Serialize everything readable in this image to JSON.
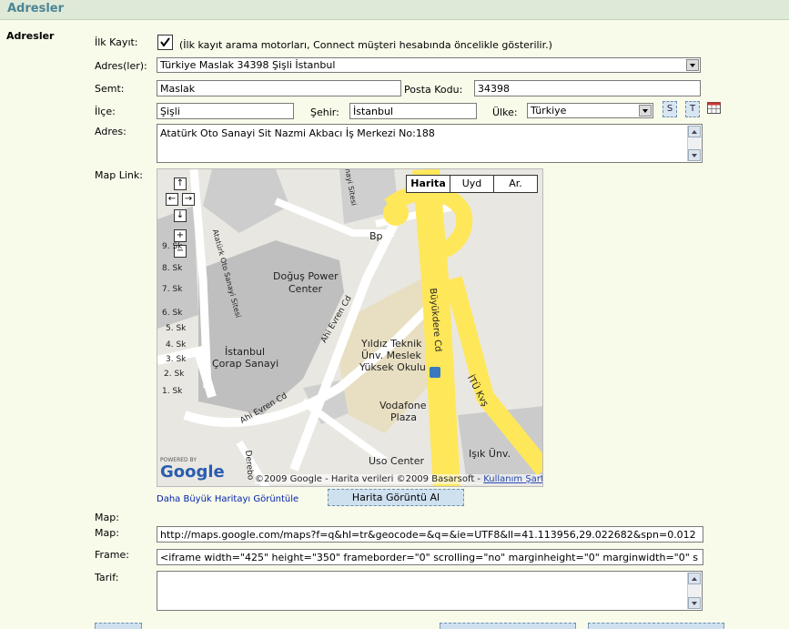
{
  "header": {
    "title": "Adresler"
  },
  "section": {
    "title": "Adresler"
  },
  "ilk_kayit": {
    "label": "İlk Kayıt:",
    "note": "(İlk kayıt arama motorları, Connect müşteri hesabında öncelikle gösterilir.)",
    "checked": true
  },
  "adresler": {
    "label": "Adres(ler):",
    "selected": "Türkiye Maslak 34398 Şişli İstanbul"
  },
  "semt": {
    "label": "Semt:",
    "value": "Maslak"
  },
  "posta_kodu": {
    "label": "Posta Kodu:",
    "value": "34398"
  },
  "ilce": {
    "label": "İlçe:",
    "value": "Şişli"
  },
  "sehir": {
    "label": "Şehir:",
    "value": "İstanbul"
  },
  "ulke": {
    "label": "Ülke:",
    "selected": "Türkiye"
  },
  "buttons": {
    "s": "S",
    "t": "T"
  },
  "adres": {
    "label": "Adres:",
    "value": "Atatürk Oto Sanayi Sit Nazmi Akbacı İş Merkezi No:188"
  },
  "map_link": {
    "label": "Map Link:"
  },
  "map": {
    "type_buttons": [
      "Harita",
      "Uyd",
      "Ar."
    ],
    "labels": {
      "dogus": "Doğuş Power",
      "dogus2": "Center",
      "istanbul": "İstanbul",
      "corap": "Çorap Sanayi",
      "yildiz1": "Yıldız Teknik",
      "yildiz2": "Ünv. Meslek",
      "yildiz3": "Yüksek Okulu",
      "vodafone1": "Vodafone",
      "vodafone2": "Plaza",
      "uso": "Uso Center",
      "isik": "Işık Ünv.",
      "bp": "Bp",
      "buyukdere": "Büyükdere Cd",
      "itu": "İTÜ Kvş",
      "ahi1": "Ahi Evren Cd",
      "ahi2": "Ahi Evren Cd",
      "oto": "Atatürk Oto Sanayi Sitesi",
      "sanayi": "Sanayi Sitesi",
      "derebo": "Derebo",
      "copyright": "©2009 Google - Harita verileri ©2009 Basarsoft - ",
      "terms": "Kullanım Şartları",
      "powered": "POWERED BY",
      "google": "Google"
    },
    "streets": [
      "1. Sk",
      "2. Sk",
      "3. Sk",
      "4. Sk",
      "5. Sk",
      "6. Sk",
      "7. Sk",
      "8. Sk",
      "9. Sk"
    ]
  },
  "larger_map_link": "Daha Büyük Haritayı Görüntüle",
  "harita_btn": "Harita Görüntü Al",
  "map_label1": "Map:",
  "map_label2": "Map:",
  "map_url": "http://maps.google.com/maps?f=q&hl=tr&geocode=&q=&ie=UTF8&ll=41.113956,29.022682&spn=0.012",
  "frame": {
    "label": "Frame:",
    "value": "<iframe width=\"425\" height=\"350\" frameborder=\"0\" scrolling=\"no\" marginheight=\"0\" marginwidth=\"0\" s"
  },
  "tarif": {
    "label": "Tarif:",
    "value": ""
  },
  "colors": {
    "header_bg": "#dfe9d7",
    "header_text": "#4b8595",
    "page_bg": "#f9fbea",
    "road_yellow": "#ffe75a"
  }
}
